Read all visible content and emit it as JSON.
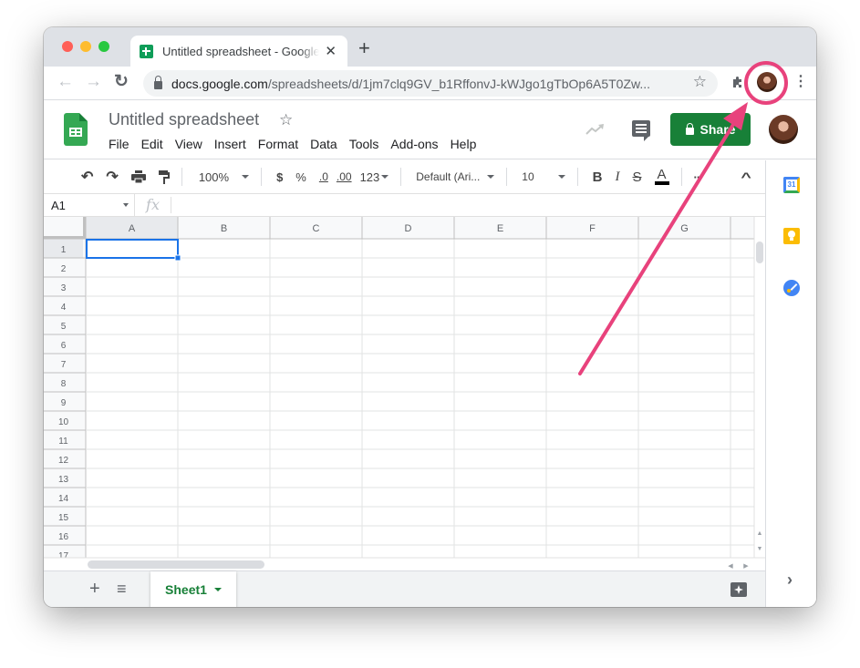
{
  "browser": {
    "tab_title": "Untitled spreadsheet - Google Sheets",
    "url_domain": "docs.google.com",
    "url_path": "/spreadsheets/d/1jm7clq9GV_b1RffonvJ-kWJgo1gTbOp6A5T0Zw...",
    "close_tab_glyph": "✕",
    "new_tab_glyph": "+",
    "back_glyph": "←",
    "forward_glyph": "→",
    "reload_glyph": "↻",
    "bookmark_glyph": "☆",
    "menu_glyph": "⋮",
    "traffic_lights": {
      "close": "#ff5f57",
      "minimize": "#febc2e",
      "zoom": "#28c840"
    }
  },
  "app": {
    "doc_title": "Untitled spreadsheet",
    "star_glyph": "☆",
    "menus": [
      "File",
      "Edit",
      "View",
      "Insert",
      "Format",
      "Data",
      "Tools",
      "Add-ons",
      "Help"
    ],
    "share_label": "Share",
    "brand_color": "#188038"
  },
  "toolbar": {
    "undo": "↶",
    "redo": "↷",
    "zoom": "100%",
    "currency": "$",
    "percent": "%",
    "decrease_decimal": ".0",
    "increase_decimal": ".00",
    "more_formats": "123",
    "font": "Default (Ari...",
    "font_size": "10",
    "bold": "B",
    "italic": "I",
    "strikethrough": "S",
    "text_color": "A",
    "more": "···",
    "collapse": "^"
  },
  "formula_bar": {
    "cell_ref": "A1",
    "fx": "fx",
    "value": ""
  },
  "grid": {
    "columns": [
      "A",
      "B",
      "C",
      "D",
      "E",
      "F",
      "G"
    ],
    "rows": [
      "1",
      "2",
      "3",
      "4",
      "5",
      "6",
      "7",
      "8",
      "9",
      "10",
      "11",
      "12",
      "13",
      "14",
      "15",
      "16",
      "17"
    ],
    "selected_cell": "A1"
  },
  "sheets": {
    "add_glyph": "+",
    "list_glyph": "≡",
    "tabs": [
      {
        "label": "Sheet1",
        "active": true
      }
    ]
  },
  "side_panel": {
    "apps": [
      "calendar",
      "keep",
      "tasks"
    ],
    "calendar_label": "31",
    "expand_glyph": "›"
  },
  "annotation": {
    "color": "#e8427c",
    "target": "profile-avatar"
  }
}
